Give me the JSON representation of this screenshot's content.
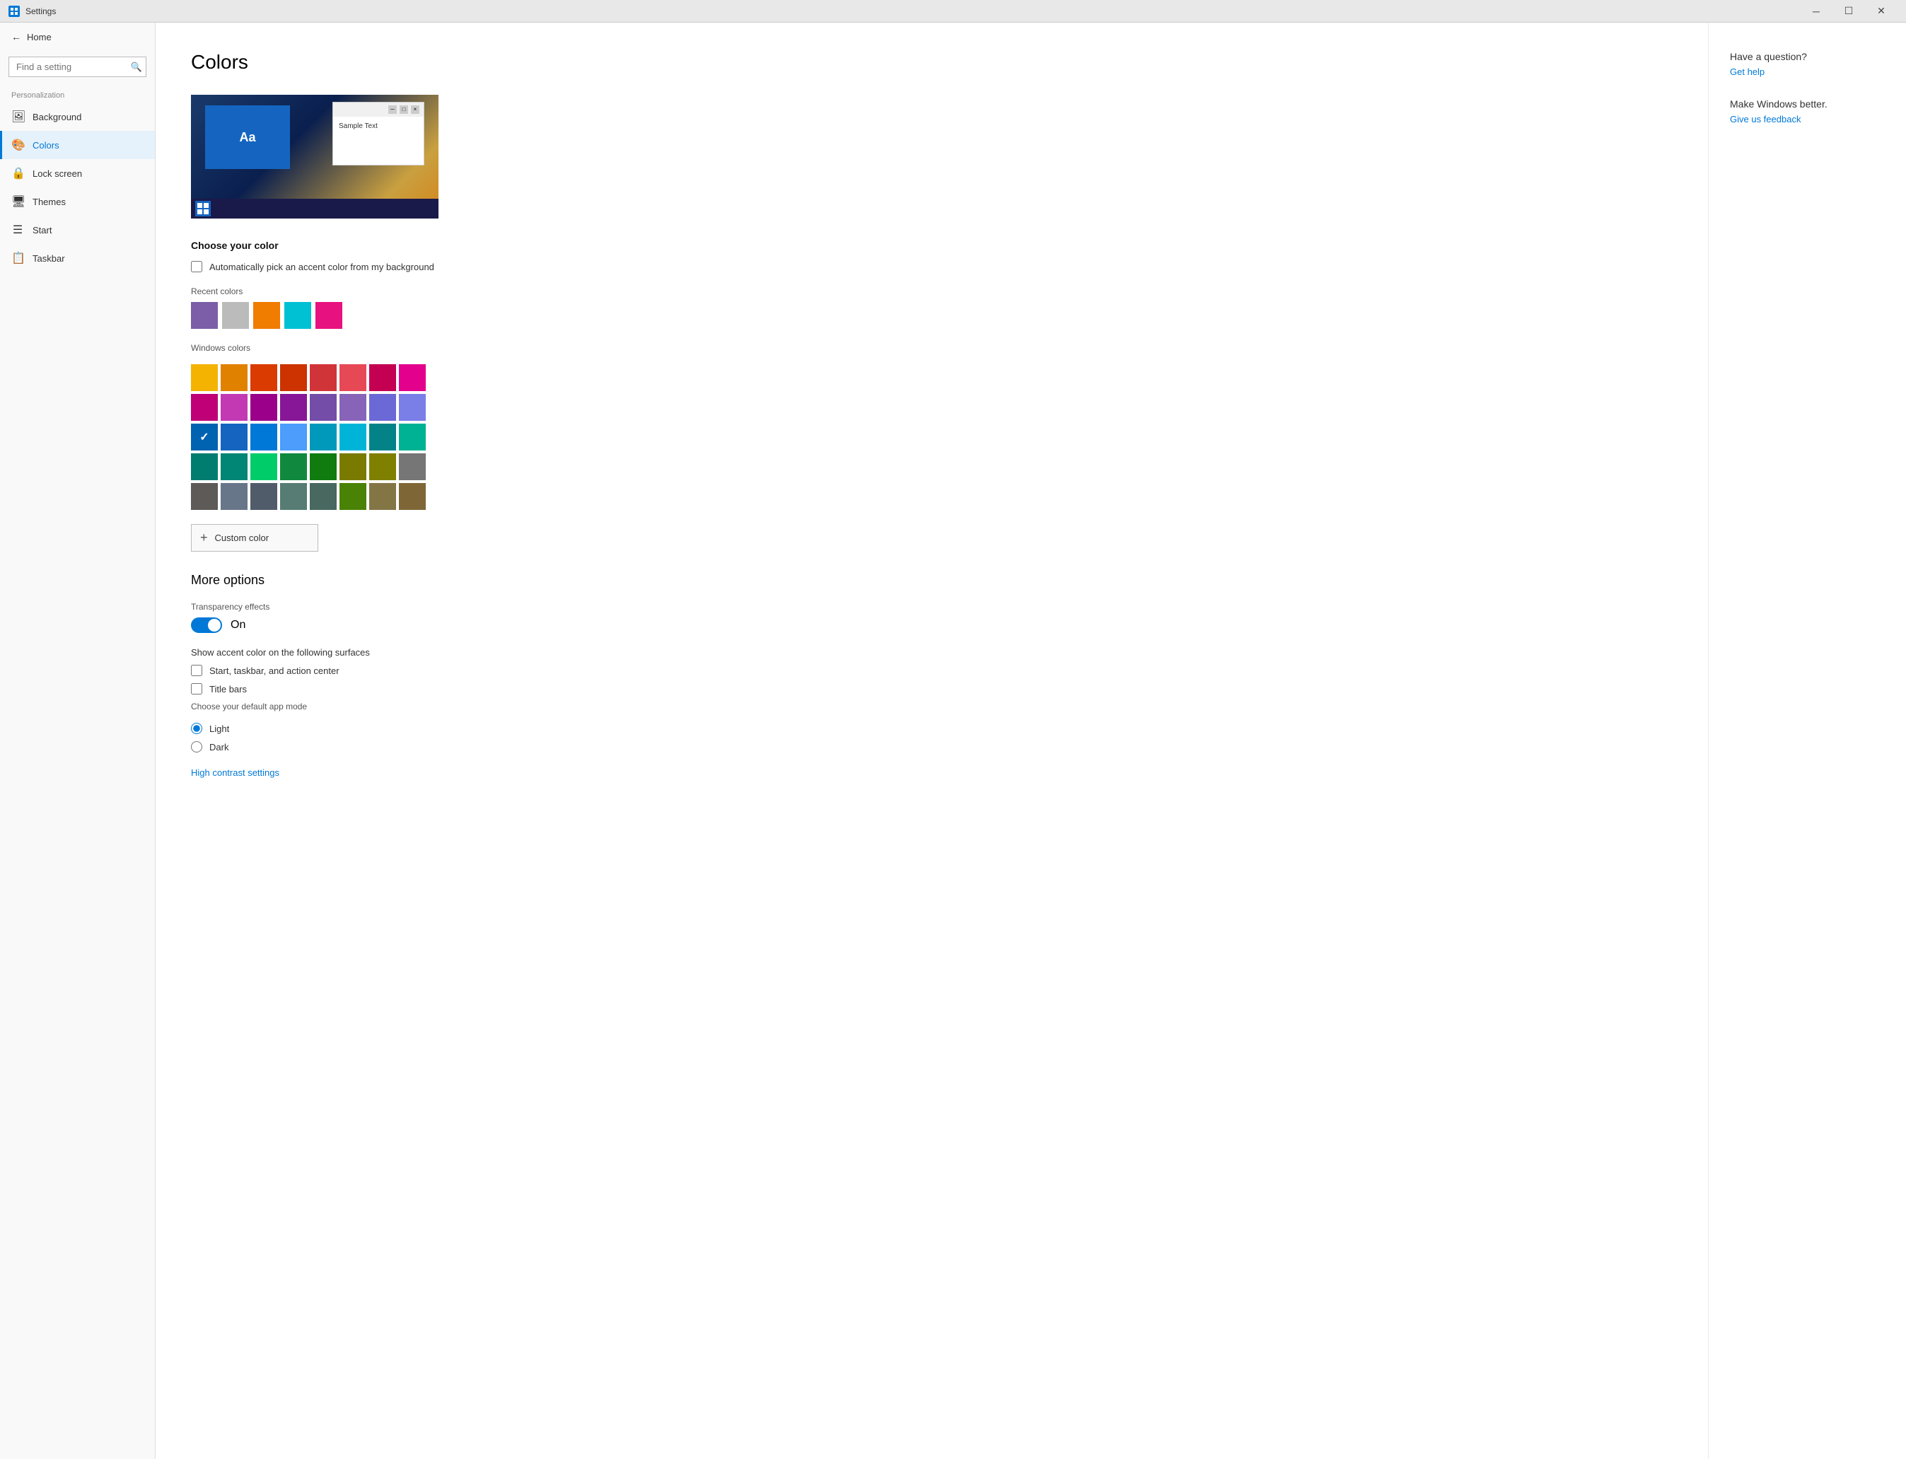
{
  "titlebar": {
    "title": "Settings",
    "minimize": "─",
    "maximize": "☐",
    "close": "✕"
  },
  "sidebar": {
    "back_label": "Home",
    "search_placeholder": "Find a setting",
    "section_label": "Personalization",
    "items": [
      {
        "id": "background",
        "icon": "🖼",
        "label": "Background"
      },
      {
        "id": "colors",
        "icon": "🎨",
        "label": "Colors",
        "active": true
      },
      {
        "id": "lock-screen",
        "icon": "🔒",
        "label": "Lock screen"
      },
      {
        "id": "themes",
        "icon": "🖥",
        "label": "Themes"
      },
      {
        "id": "start",
        "icon": "☰",
        "label": "Start"
      },
      {
        "id": "taskbar",
        "icon": "📋",
        "label": "Taskbar"
      }
    ]
  },
  "main": {
    "page_title": "Colors",
    "preview_sample_text": "Sample Text",
    "preview_aa": "Aa",
    "choose_color_title": "Choose your color",
    "auto_pick_label": "Automatically pick an accent color from my background",
    "recent_colors_label": "Recent colors",
    "recent_colors": [
      "#7b5ea7",
      "#bbbbbb",
      "#f07c00",
      "#00c0d4",
      "#e81180"
    ],
    "windows_colors_label": "Windows colors",
    "windows_colors": [
      "#f4b301",
      "#e18100",
      "#da3b00",
      "#cc3300",
      "#d13438",
      "#e74856",
      "#c30052",
      "#e3008c",
      "#bf0077",
      "#c239b3",
      "#9a0089",
      "#881798",
      "#744da9",
      "#8764b8",
      "#6b69d6",
      "#7a7fe8",
      "#0063b1",
      "#1565c0",
      "#0078d7",
      "#4c9dfc",
      "#0099bc",
      "#00b4d8",
      "#038387",
      "#00b294",
      "#007d6f",
      "#018574",
      "#00cc6a",
      "#10893e",
      "#107c10",
      "#7a7a00",
      "#808000",
      "#767676",
      "#5d5a58",
      "#68768a",
      "#515c6b",
      "#567c73",
      "#486860",
      "#498205",
      "#847545",
      "#7e6636"
    ],
    "selected_color_index": 16,
    "custom_color_label": "Custom color",
    "more_options_title": "More options",
    "transparency_label": "Transparency effects",
    "transparency_state": "On",
    "transparency_on": true,
    "show_accent_label": "Show accent color on the following surfaces",
    "check_start_label": "Start, taskbar, and action center",
    "check_title_bars_label": "Title bars",
    "app_mode_title": "Choose your default app mode",
    "radio_light_label": "Light",
    "radio_dark_label": "Dark",
    "high_contrast_link": "High contrast settings"
  },
  "right_panel": {
    "question": "Have a question?",
    "get_help": "Get help",
    "make_better": "Make Windows better.",
    "feedback": "Give us feedback"
  }
}
